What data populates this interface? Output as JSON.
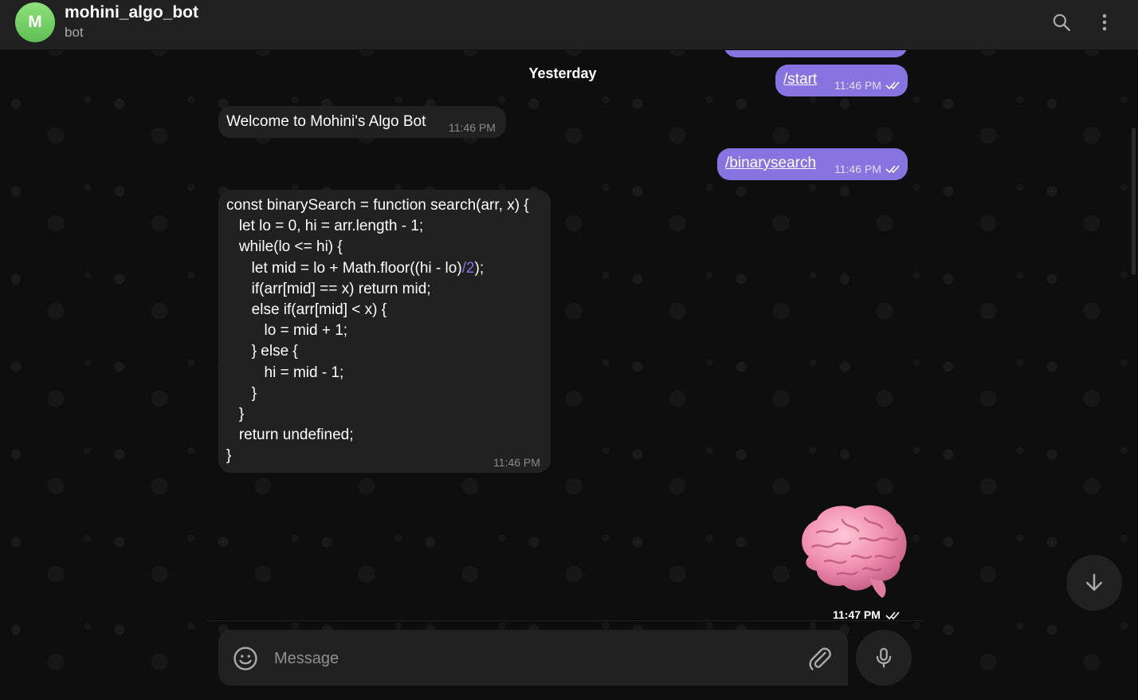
{
  "header": {
    "avatar_letter": "M",
    "title": "mohini_algo_bot",
    "subtitle": "bot"
  },
  "date_separator": "Yesterday",
  "messages": {
    "start": {
      "text": "/start",
      "time": "11:46 PM"
    },
    "welcome": {
      "text": "Welcome to Mohini's Algo Bot",
      "time": "11:46 PM"
    },
    "binarysearch": {
      "text": "/binarysearch",
      "time": "11:46 PM"
    },
    "code": {
      "lines": [
        "const binarySearch = function search(arr, x) {",
        "   let lo = 0, hi = arr.length - 1;",
        "   while(lo <= hi) {",
        "      let mid = lo + Math.floor((hi - lo)",
        "      if(arr[mid] == x) return mid;",
        "      else if(arr[mid] < x) {",
        "         lo = mid + 1;",
        "      } else {",
        "         hi = mid - 1;",
        "      }",
        "   }",
        "   return undefined;",
        "}"
      ],
      "accent_part": "/2",
      "line4_tail": ");",
      "time": "11:46 PM"
    },
    "sticker": {
      "icon": "brain-sticker",
      "time": "11:47 PM"
    }
  },
  "composer": {
    "placeholder": "Message"
  },
  "colors": {
    "accent": "#8774e1",
    "header_bg": "#212121",
    "bubble_in": "#212121",
    "avatar": "#6fcf5f"
  }
}
